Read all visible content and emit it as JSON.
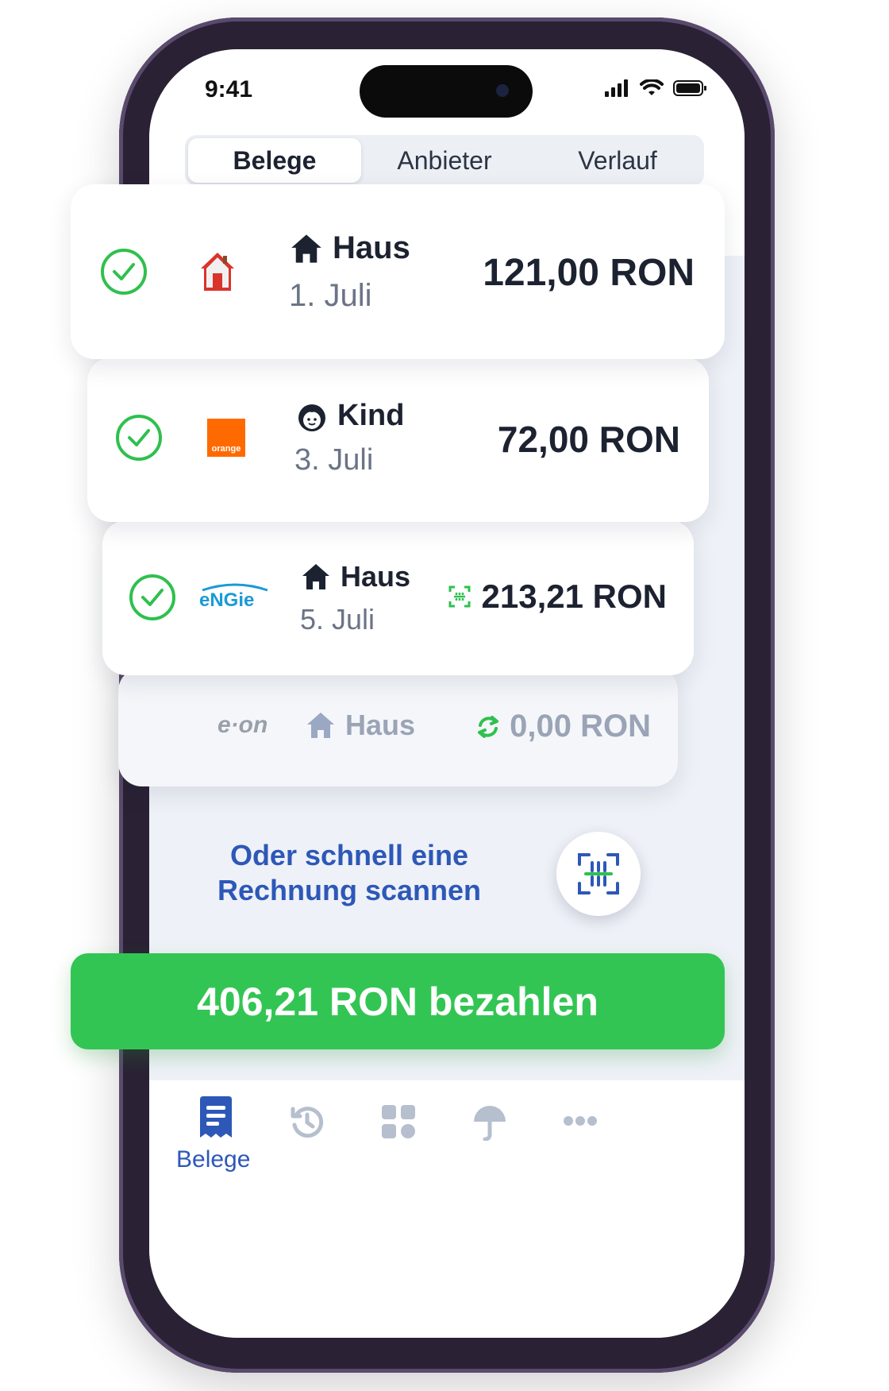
{
  "status_bar": {
    "time": "9:41"
  },
  "segmented_control": {
    "tabs": [
      "Belege",
      "Anbieter",
      "Verlauf"
    ],
    "active": "Belege"
  },
  "bills": [
    {
      "provider": "house-logo",
      "category": "Haus",
      "category_icon": "house-icon",
      "date": "1. Juli",
      "amount": "121,00 RON",
      "paid_check": true
    },
    {
      "provider": "orange",
      "category": "Kind",
      "category_icon": "child-face-icon",
      "date": "3. Juli",
      "amount": "72,00 RON",
      "paid_check": true
    },
    {
      "provider": "engie",
      "category": "Haus",
      "category_icon": "house-icon",
      "date": "5. Juli",
      "amount": "213,21 RON",
      "amount_icon": "scan-code-icon",
      "paid_check": true
    },
    {
      "provider": "e·on",
      "category": "Haus",
      "category_icon": "house-icon",
      "amount": "0,00 RON",
      "amount_icon": "refresh-icon"
    }
  ],
  "provider_logos": {
    "orange": "orange",
    "engie": "eNGie",
    "eon": "e·on"
  },
  "scan_prompt": "Oder schnell eine Rechnung scannen",
  "pay_button": "406,21 RON bezahlen",
  "tab_bar": {
    "items": [
      "receipts-icon",
      "history-icon",
      "grid-icon",
      "umbrella-icon",
      "more-icon"
    ],
    "active_label": "Belege"
  },
  "colors": {
    "green": "#33c553",
    "blue": "#2d58b8",
    "text": "#1c2230",
    "muted": "#6b7486"
  }
}
